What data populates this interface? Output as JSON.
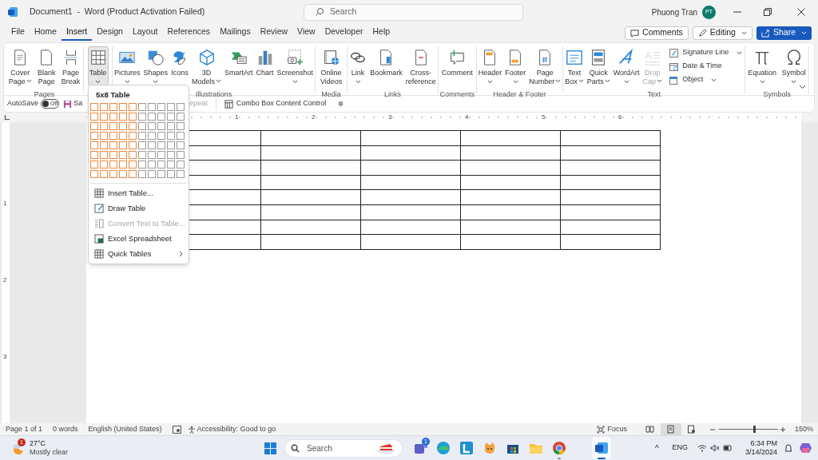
{
  "title_bar": {
    "title": "Document1  -  Word (Product Activation Failed)",
    "search_placeholder": "Search",
    "user_name": "Phuong Tran",
    "avatar_initials": "PT"
  },
  "tabs": [
    {
      "label": "File",
      "selected": false
    },
    {
      "label": "Home",
      "selected": false
    },
    {
      "label": "Insert",
      "selected": true
    },
    {
      "label": "Design",
      "selected": false
    },
    {
      "label": "Layout",
      "selected": false
    },
    {
      "label": "References",
      "selected": false
    },
    {
      "label": "Mailings",
      "selected": false
    },
    {
      "label": "Review",
      "selected": false
    },
    {
      "label": "View",
      "selected": false
    },
    {
      "label": "Developer",
      "selected": false
    },
    {
      "label": "Help",
      "selected": false
    }
  ],
  "header_buttons": [
    {
      "kind": "outline",
      "label": "Comments",
      "caret": false
    },
    {
      "kind": "outline",
      "label": "Editing",
      "caret": true
    },
    {
      "kind": "primary",
      "label": "Share",
      "caret": true
    }
  ],
  "ribbon_groups": [
    {
      "label": "Pages",
      "items": [
        {
          "kind": "large",
          "lines": [
            "Cover",
            "Page"
          ],
          "caret": true,
          "pressed": false,
          "disabled": false
        },
        {
          "kind": "large",
          "lines": [
            "Blank",
            "Page"
          ],
          "caret": false,
          "pressed": false,
          "disabled": false
        },
        {
          "kind": "large",
          "lines": [
            "Page",
            "Break"
          ],
          "caret": false,
          "pressed": false,
          "disabled": false
        }
      ]
    },
    {
      "items": [
        {
          "kind": "large",
          "lines": [
            "Table"
          ],
          "caret": true,
          "pressed": true,
          "disabled": false
        }
      ]
    },
    {
      "label": "Illustrations",
      "items": [
        {
          "kind": "large",
          "lines": [
            "Pictures"
          ],
          "caret": true,
          "pressed": false,
          "disabled": false
        },
        {
          "kind": "large",
          "lines": [
            "Shapes"
          ],
          "caret": true,
          "pressed": false,
          "disabled": false
        },
        {
          "kind": "large",
          "lines": [
            "Icons"
          ],
          "caret": false,
          "pressed": false,
          "disabled": false
        },
        {
          "kind": "large",
          "lines": [
            "3D",
            "Models"
          ],
          "caret": true,
          "pressed": false,
          "disabled": false
        },
        {
          "kind": "large",
          "lines": [
            "SmartArt"
          ],
          "caret": false,
          "pressed": false,
          "disabled": false
        },
        {
          "kind": "large",
          "lines": [
            "Chart"
          ],
          "caret": false,
          "pressed": false,
          "disabled": false
        },
        {
          "kind": "large",
          "lines": [
            "Screenshot"
          ],
          "caret": true,
          "pressed": false,
          "disabled": false
        }
      ]
    },
    {
      "label": "Media",
      "items": [
        {
          "kind": "large",
          "lines": [
            "Online",
            "Videos"
          ],
          "caret": false,
          "pressed": false,
          "disabled": false
        }
      ]
    },
    {
      "label": "Links",
      "items": [
        {
          "kind": "large",
          "lines": [
            "Link"
          ],
          "caret": true,
          "pressed": false,
          "disabled": false
        },
        {
          "kind": "large",
          "lines": [
            "Bookmark"
          ],
          "caret": false,
          "pressed": false,
          "disabled": false
        },
        {
          "kind": "large",
          "lines": [
            "Cross-",
            "reference"
          ],
          "caret": false,
          "pressed": false,
          "disabled": false
        }
      ]
    },
    {
      "label": "Comments",
      "items": [
        {
          "kind": "large",
          "lines": [
            "Comment"
          ],
          "caret": false,
          "pressed": false,
          "disabled": false
        }
      ]
    },
    {
      "label": "Header & Footer",
      "items": [
        {
          "kind": "large",
          "lines": [
            "Header"
          ],
          "caret": true,
          "pressed": false,
          "disabled": false
        },
        {
          "kind": "large",
          "lines": [
            "Footer"
          ],
          "caret": true,
          "pressed": false,
          "disabled": false
        },
        {
          "kind": "large",
          "lines": [
            "Page",
            "Number"
          ],
          "caret": true,
          "pressed": false,
          "disabled": false
        }
      ]
    },
    {
      "label": "Text",
      "items": [
        {
          "kind": "large",
          "lines": [
            "Text",
            "Box"
          ],
          "caret": true,
          "pressed": false,
          "disabled": false
        },
        {
          "kind": "large",
          "lines": [
            "Quick",
            "Parts"
          ],
          "caret": true,
          "pressed": false,
          "disabled": false
        },
        {
          "kind": "large",
          "lines": [
            "WordArt"
          ],
          "caret": true,
          "pressed": false,
          "disabled": false
        },
        {
          "kind": "large",
          "lines": [
            "Drop",
            "Cap"
          ],
          "caret": true,
          "pressed": false,
          "disabled": true
        },
        {
          "kind": "small",
          "lines": [
            "Signature Line"
          ],
          "caret": true,
          "pressed": false,
          "disabled": false
        },
        {
          "kind": "small",
          "lines": [
            "Date & Time"
          ],
          "caret": false,
          "pressed": false,
          "disabled": false
        },
        {
          "kind": "small",
          "lines": [
            "Object"
          ],
          "caret": true,
          "pressed": false,
          "disabled": false
        }
      ]
    },
    {
      "label": "Symbols",
      "items": [
        {
          "kind": "large",
          "lines": [
            "Equation"
          ],
          "caret": true,
          "pressed": false,
          "disabled": false
        },
        {
          "kind": "large",
          "lines": [
            "Symbol"
          ],
          "caret": true,
          "pressed": false,
          "disabled": false
        }
      ]
    }
  ],
  "quick_access": {
    "autosave_label": "AutoSave",
    "autosave_on": false,
    "autosave_state": "Off",
    "save_label": "Sa",
    "repeat_label": "epeat",
    "combo_label": "Combo Box Content Control"
  },
  "ruler_marks": [
    "1",
    "2",
    "3",
    "4",
    "5",
    "6"
  ],
  "vertical_ruler_marks": [
    "1",
    "2",
    "3"
  ],
  "document_table": {
    "rows": [
      [
        {},
        {},
        {},
        {},
        {}
      ],
      [
        {},
        {},
        {},
        {},
        {}
      ],
      [
        {},
        {},
        {},
        {},
        {}
      ],
      [
        {},
        {},
        {},
        {},
        {}
      ],
      [
        {},
        {},
        {},
        {},
        {}
      ],
      [
        {},
        {},
        {},
        {},
        {}
      ],
      [
        {},
        {},
        {},
        {},
        {}
      ],
      [
        {},
        {},
        {},
        {},
        {}
      ]
    ]
  },
  "table_menu": {
    "title": "5x8 Table",
    "grid": [
      [
        true,
        true,
        true,
        true,
        true,
        false,
        false,
        false,
        false,
        false
      ],
      [
        true,
        true,
        true,
        true,
        true,
        false,
        false,
        false,
        false,
        false
      ],
      [
        true,
        true,
        true,
        true,
        true,
        false,
        false,
        false,
        false,
        false
      ],
      [
        true,
        true,
        true,
        true,
        true,
        false,
        false,
        false,
        false,
        false
      ],
      [
        true,
        true,
        true,
        true,
        true,
        false,
        false,
        false,
        false,
        false
      ],
      [
        true,
        true,
        true,
        true,
        true,
        false,
        false,
        false,
        false,
        false
      ],
      [
        true,
        true,
        true,
        true,
        true,
        false,
        false,
        false,
        false,
        false
      ],
      [
        true,
        true,
        true,
        true,
        true,
        false,
        false,
        false,
        false,
        false
      ]
    ],
    "items": [
      {
        "label": "Insert Table...",
        "disabled": false,
        "submenu": false
      },
      {
        "label": "Draw Table",
        "disabled": false,
        "submenu": false
      },
      {
        "label": "Convert Text to Table...",
        "disabled": true,
        "submenu": false
      },
      {
        "label": "Excel Spreadsheet",
        "disabled": false,
        "submenu": false
      },
      {
        "label": "Quick Tables",
        "disabled": false,
        "submenu": true
      }
    ]
  },
  "status_bar": {
    "items": [
      "Page 1 of 1",
      "0 words",
      "English (United States)"
    ],
    "accessibility": "Accessibility: Good to go",
    "focus": "Focus",
    "views": [
      {
        "selected": false
      },
      {
        "selected": true
      },
      {
        "selected": false
      }
    ],
    "zoom": {
      "level": 0.6,
      "label": "150%"
    }
  },
  "taskbar": {
    "weather": {
      "badge": "1",
      "temperature": "27°C",
      "condition": "Mostly clear"
    },
    "search_placeholder": "Search",
    "apps": [
      {
        "badge": "1",
        "running": false,
        "active": false
      },
      {
        "running": false,
        "active": false
      },
      {
        "running": false,
        "active": false
      },
      {
        "running": false,
        "active": false
      },
      {
        "running": false,
        "active": false
      },
      {
        "running": false,
        "active": false
      },
      {
        "running": true,
        "active": false
      },
      {
        "running": true,
        "active": true
      }
    ],
    "tray": {
      "chevron": "^",
      "language": "ENG",
      "time": "6:34 PM",
      "date": "3/14/2024"
    }
  }
}
